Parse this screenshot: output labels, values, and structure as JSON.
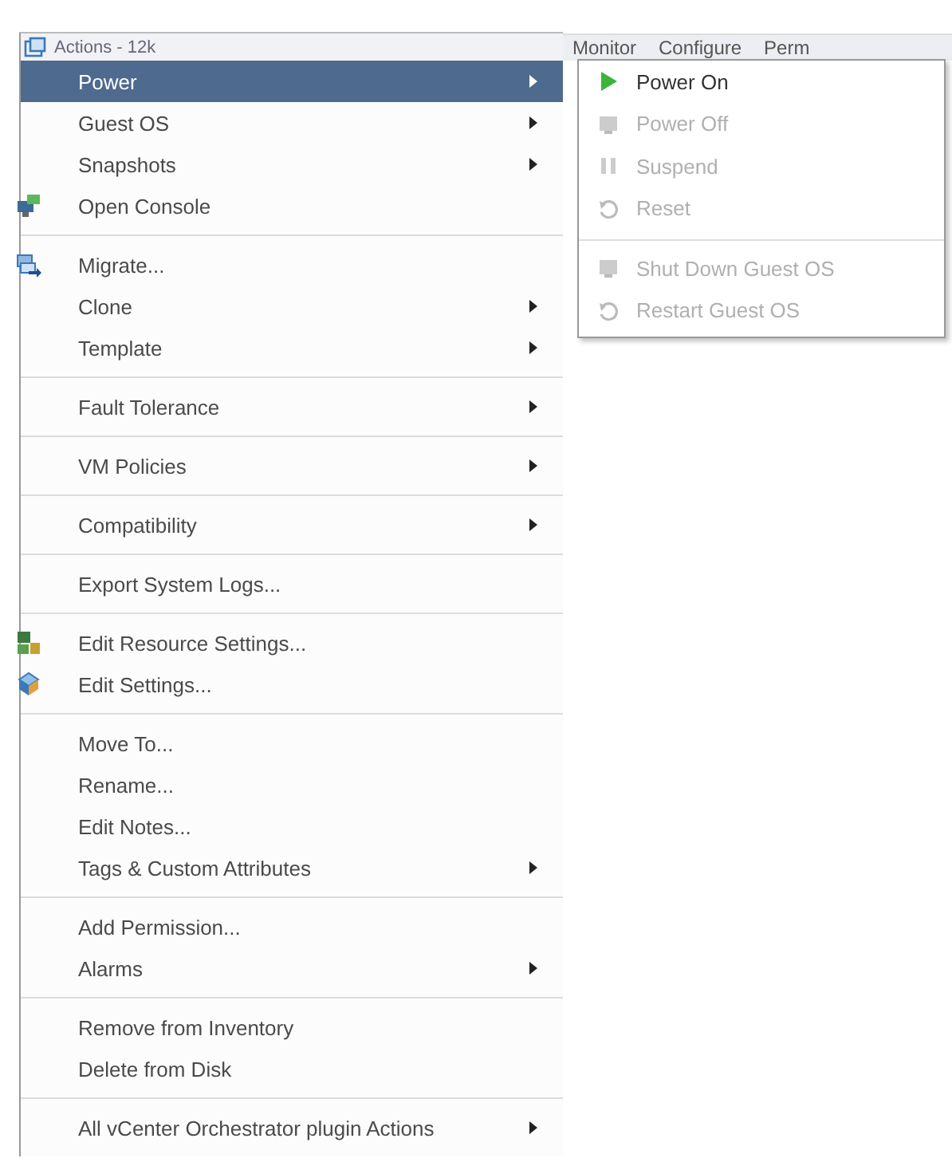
{
  "tabs": [
    "Monitor",
    "Configure",
    "Perm"
  ],
  "menu": {
    "title": "Actions - 12k",
    "groups": [
      [
        {
          "label": "Power",
          "submenu": true,
          "selected": true
        },
        {
          "label": "Guest OS",
          "submenu": true,
          "selected": false
        },
        {
          "label": "Snapshots",
          "submenu": true,
          "selected": false
        },
        {
          "label": "Open Console",
          "submenu": false,
          "selected": false,
          "kind": "console"
        }
      ],
      [
        {
          "label": "Migrate...",
          "submenu": false,
          "selected": false,
          "kind": "migrate"
        },
        {
          "label": "Clone",
          "submenu": true,
          "selected": false
        },
        {
          "label": "Template",
          "submenu": true,
          "selected": false
        }
      ],
      [
        {
          "label": "Fault Tolerance",
          "submenu": true,
          "selected": false
        }
      ],
      [
        {
          "label": "VM Policies",
          "submenu": true,
          "selected": false
        }
      ],
      [
        {
          "label": "Compatibility",
          "submenu": true,
          "selected": false
        }
      ],
      [
        {
          "label": "Export System Logs...",
          "submenu": false,
          "selected": false
        }
      ],
      [
        {
          "label": "Edit Resource Settings...",
          "submenu": false,
          "selected": false,
          "kind": "resource"
        },
        {
          "label": "Edit Settings...",
          "submenu": false,
          "selected": false,
          "kind": "settings"
        }
      ],
      [
        {
          "label": "Move To...",
          "submenu": false,
          "selected": false
        },
        {
          "label": "Rename...",
          "submenu": false,
          "selected": false
        },
        {
          "label": "Edit Notes...",
          "submenu": false,
          "selected": false
        },
        {
          "label": "Tags & Custom Attributes",
          "submenu": true,
          "selected": false
        }
      ],
      [
        {
          "label": "Add Permission...",
          "submenu": false,
          "selected": false
        },
        {
          "label": "Alarms",
          "submenu": true,
          "selected": false
        }
      ],
      [
        {
          "label": "Remove from Inventory",
          "submenu": false,
          "selected": false
        },
        {
          "label": "Delete from Disk",
          "submenu": false,
          "selected": false
        }
      ],
      [
        {
          "label": "All vCenter Orchestrator plugin Actions",
          "submenu": true,
          "selected": false
        }
      ]
    ]
  },
  "submenu": {
    "groups": [
      [
        {
          "label": "Power On",
          "disabled": false,
          "kind": "play"
        },
        {
          "label": "Power Off",
          "disabled": true,
          "kind": "stop"
        },
        {
          "label": "Suspend",
          "disabled": true,
          "kind": "pause"
        },
        {
          "label": "Reset",
          "disabled": true,
          "kind": "reset"
        }
      ],
      [
        {
          "label": "Shut Down Guest OS",
          "disabled": true,
          "kind": "stop"
        },
        {
          "label": "Restart Guest OS",
          "disabled": true,
          "kind": "reset"
        }
      ]
    ]
  }
}
